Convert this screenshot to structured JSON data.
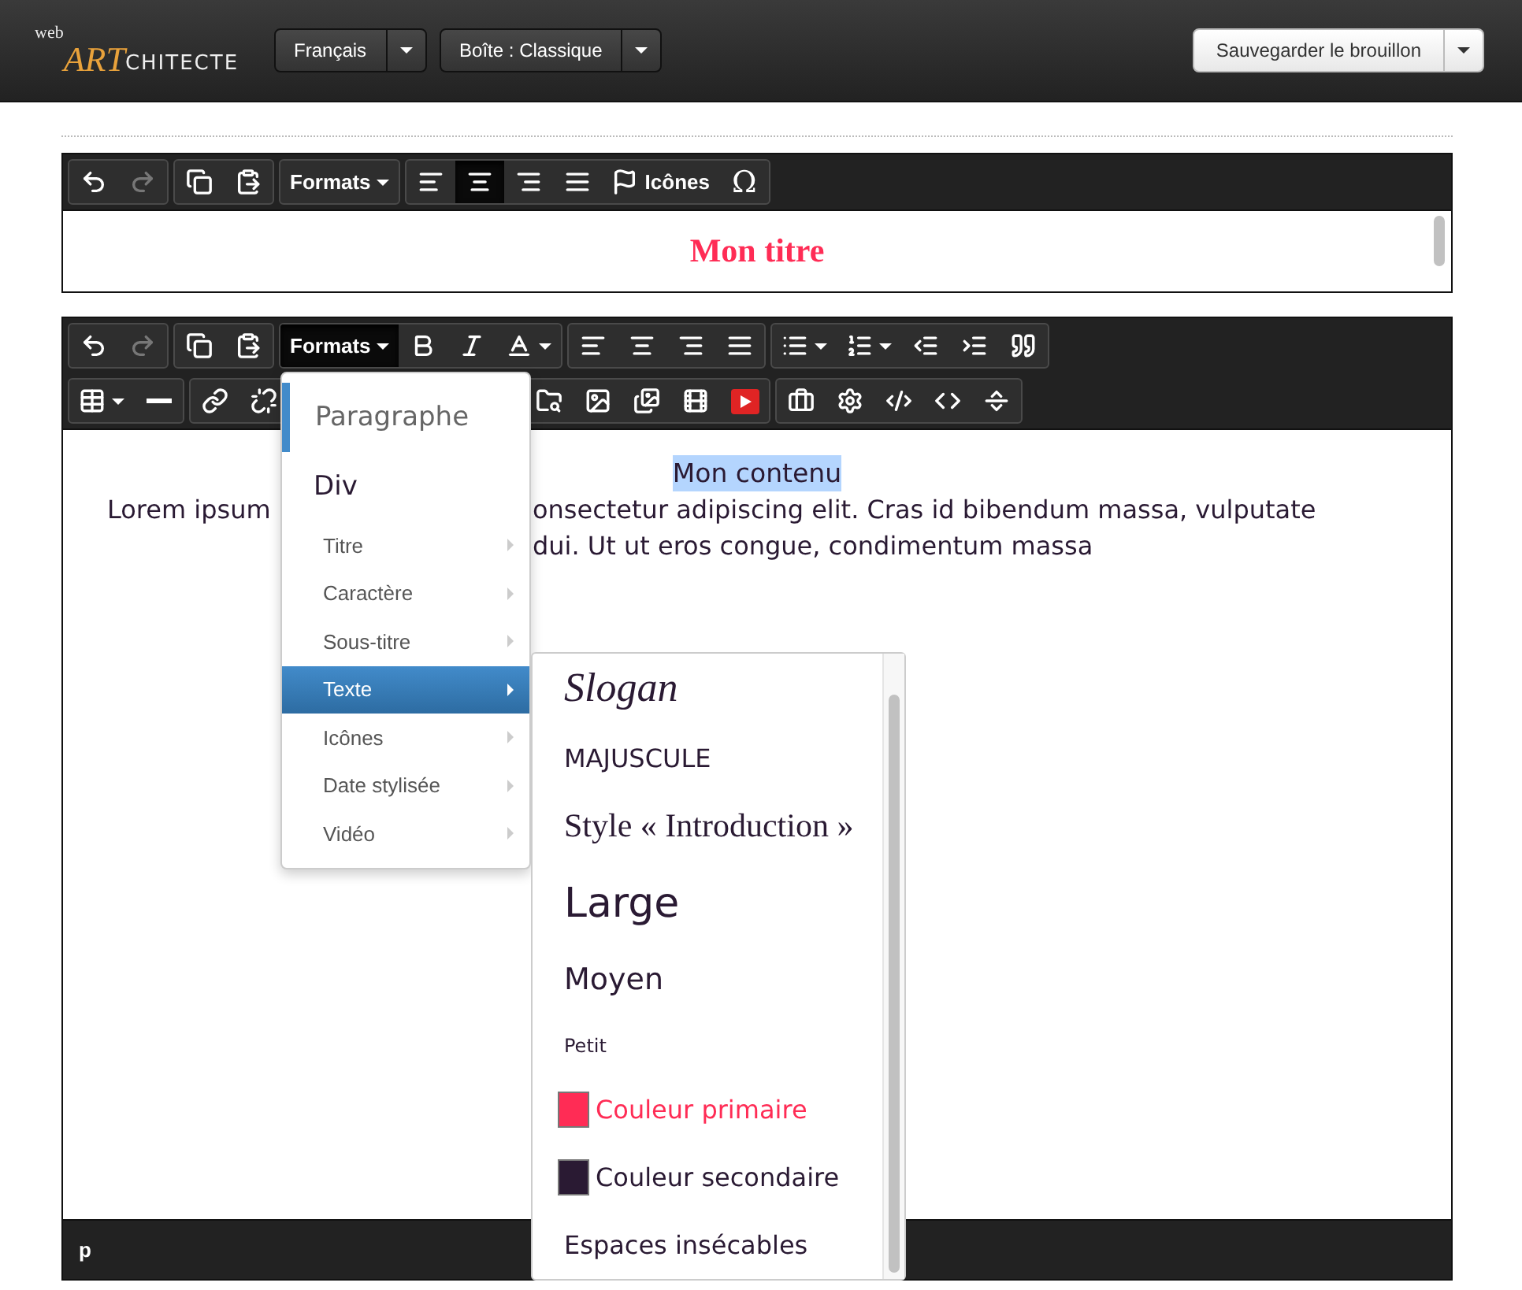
{
  "header": {
    "logo": {
      "prefix": "web",
      "accent": "ART",
      "rest": "CHITECTE"
    },
    "dropdowns": [
      {
        "label": "Français"
      },
      {
        "label": "Boîte : Classique"
      }
    ],
    "save_button": {
      "label": "Sauvegarder le brouillon"
    }
  },
  "title_editor": {
    "toolbar": [
      [
        {
          "kind": "undo",
          "disabled": false
        },
        {
          "kind": "redo",
          "disabled": true
        }
      ],
      [
        {
          "kind": "copy",
          "disabled": false
        },
        {
          "kind": "paste",
          "disabled": false
        }
      ],
      [
        {
          "kind": "menu",
          "label": "Formats",
          "active": false
        }
      ],
      [
        {
          "kind": "align-left",
          "active": false
        },
        {
          "kind": "align-center",
          "active": true
        },
        {
          "kind": "align-right",
          "active": false
        },
        {
          "kind": "justify",
          "active": false
        },
        {
          "kind": "flag",
          "label": "Icônes",
          "active": false
        },
        {
          "kind": "char",
          "label": "Ω",
          "active": false
        }
      ]
    ],
    "content": "Mon titre"
  },
  "content_editor": {
    "toolbar_rows": [
      [
        [
          {
            "kind": "undo",
            "disabled": false
          },
          {
            "kind": "redo",
            "disabled": true
          }
        ],
        [
          {
            "kind": "copy",
            "disabled": false
          },
          {
            "kind": "paste",
            "disabled": false
          }
        ],
        [
          {
            "kind": "menu",
            "label": "Formats",
            "active": true
          },
          {
            "kind": "bold",
            "active": false
          },
          {
            "kind": "italic",
            "active": false
          },
          {
            "kind": "font-color",
            "caret": true,
            "active": false
          }
        ],
        [
          {
            "kind": "align-left",
            "active": false
          },
          {
            "kind": "align-center",
            "active": false
          },
          {
            "kind": "align-right",
            "active": false
          },
          {
            "kind": "justify",
            "active": false
          }
        ],
        [
          {
            "kind": "bullets",
            "caret": true
          },
          {
            "kind": "numbers",
            "caret": true
          },
          {
            "kind": "outdent"
          },
          {
            "kind": "indent"
          },
          {
            "kind": "quote"
          }
        ]
      ],
      [
        [
          {
            "kind": "table",
            "caret": true
          },
          {
            "kind": "rule"
          }
        ],
        [
          {
            "kind": "link"
          },
          {
            "kind": "unlink"
          },
          {
            "kind": "gap"
          },
          {
            "kind": "file-search"
          },
          {
            "kind": "image"
          },
          {
            "kind": "gallery"
          },
          {
            "kind": "film"
          },
          {
            "kind": "video"
          }
        ],
        [
          {
            "kind": "briefcase"
          },
          {
            "kind": "gear"
          },
          {
            "kind": "code"
          },
          {
            "kind": "source"
          },
          {
            "kind": "page-break"
          }
        ]
      ]
    ],
    "heading": {
      "text": "Mon contenu",
      "selected": true
    },
    "paragraph_lines": [
      {
        "left": "Lorem ipsum",
        "right": "onsectetur adipiscing elit. Cras id bibendum massa, vulputate"
      },
      {
        "right": "dui. Ut ut eros congue, condimentum massa"
      }
    ],
    "status_path": "p"
  },
  "formats_menu": {
    "items": [
      {
        "label": "Paragraphe",
        "kind": "block",
        "selected": true
      },
      {
        "label": "Div",
        "kind": "block",
        "selected": false
      },
      {
        "label": "Titre",
        "kind": "submenu",
        "selected": false
      },
      {
        "label": "Caractère",
        "kind": "submenu",
        "selected": false
      },
      {
        "label": "Sous-titre",
        "kind": "submenu",
        "selected": false
      },
      {
        "label": "Texte",
        "kind": "submenu",
        "selected": true
      },
      {
        "label": "Icônes",
        "kind": "submenu",
        "selected": false
      },
      {
        "label": "Date stylisée",
        "kind": "submenu",
        "selected": false
      },
      {
        "label": "Vidéo",
        "kind": "submenu",
        "selected": false
      }
    ]
  },
  "text_submenu": {
    "items": [
      {
        "label": "Slogan",
        "kind": "script"
      },
      {
        "label": "MAJUSCULE",
        "kind": "caps"
      },
      {
        "label": "Style « Introduction »",
        "kind": "serif"
      },
      {
        "label": "Large",
        "kind": "large"
      },
      {
        "label": "Moyen",
        "kind": "medium"
      },
      {
        "label": "Petit",
        "kind": "small"
      },
      {
        "label": "Couleur primaire",
        "kind": "color",
        "color": "#ff2c55"
      },
      {
        "label": "Couleur secondaire",
        "kind": "color",
        "color": "#2a1a33"
      },
      {
        "label": "Espaces insécables",
        "kind": "plain"
      }
    ]
  }
}
